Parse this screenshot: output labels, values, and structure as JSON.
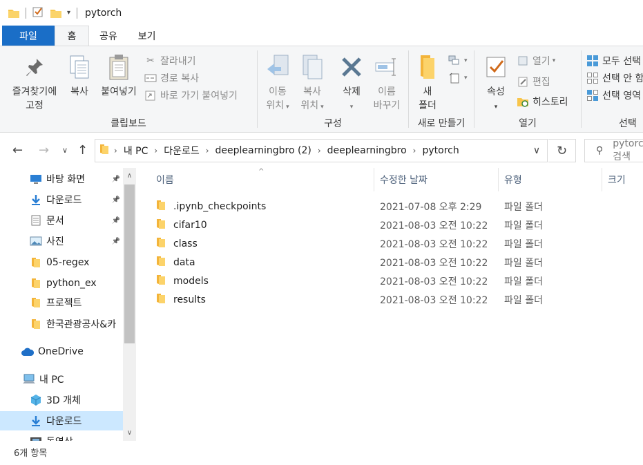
{
  "window": {
    "title": "pytorch"
  },
  "ribbon_tabs": [
    "파일",
    "홈",
    "공유",
    "보기"
  ],
  "ribbon": {
    "clipboard": {
      "label": "클립보드",
      "pin_line1": "즐겨찾기에",
      "pin_line2": "고정",
      "copy": "복사",
      "paste": "붙여넣기",
      "cut": "잘라내기",
      "copy_path": "경로 복사",
      "paste_shortcut": "바로 가기 붙여넣기"
    },
    "organize": {
      "label": "구성",
      "move_line1": "이동",
      "move_line2": "위치",
      "copyto_line1": "복사",
      "copyto_line2": "위치",
      "delete": "삭제",
      "rename_line1": "이름",
      "rename_line2": "바꾸기"
    },
    "new": {
      "label": "새로 만들기",
      "newfolder_line1": "새",
      "newfolder_line2": "폴더"
    },
    "open": {
      "label": "열기",
      "properties": "속성",
      "open": "열기",
      "edit": "편집",
      "history": "히스토리"
    },
    "select": {
      "label": "선택",
      "select_all": "모두 선택",
      "select_none": "선택 안 함",
      "invert": "선택 영역 반전"
    }
  },
  "address": {
    "crumbs": [
      "내 PC",
      "다운로드",
      "deeplearningbro (2)",
      "deeplearningbro",
      "pytorch"
    ],
    "search_placeholder": "pytorch 검색"
  },
  "nav_pane": {
    "items": [
      {
        "label": "바탕 화면",
        "icon": "desktop-icon",
        "pinned": true
      },
      {
        "label": "다운로드",
        "icon": "download-arrow-icon",
        "pinned": true
      },
      {
        "label": "문서",
        "icon": "document-icon",
        "pinned": true
      },
      {
        "label": "사진",
        "icon": "picture-icon",
        "pinned": true
      },
      {
        "label": "05-regex",
        "icon": "folder-icon",
        "pinned": false
      },
      {
        "label": "python_ex",
        "icon": "folder-icon",
        "pinned": false
      },
      {
        "label": "프로젝트",
        "icon": "folder-icon",
        "pinned": false
      },
      {
        "label": "한국관광공사&카",
        "icon": "folder-icon",
        "pinned": false
      },
      {
        "label": "OneDrive",
        "icon": "cloud-icon",
        "pinned": false
      },
      {
        "label": "내 PC",
        "icon": "computer-icon",
        "pinned": false
      },
      {
        "label": "3D 개체",
        "icon": "cube-icon",
        "pinned": false
      },
      {
        "label": "다운로드",
        "icon": "download-arrow-icon",
        "pinned": false,
        "selected": true
      },
      {
        "label": "동영상",
        "icon": "film-icon",
        "pinned": false
      }
    ]
  },
  "file_list": {
    "columns": [
      "이름",
      "수정한 날짜",
      "유형",
      "크기"
    ],
    "rows": [
      {
        "name": ".ipynb_checkpoints",
        "date": "2021-07-08 오후 2:29",
        "type": "파일 폴더"
      },
      {
        "name": "cifar10",
        "date": "2021-08-03 오전 10:22",
        "type": "파일 폴더"
      },
      {
        "name": "class",
        "date": "2021-08-03 오전 10:22",
        "type": "파일 폴더"
      },
      {
        "name": "data",
        "date": "2021-08-03 오전 10:22",
        "type": "파일 폴더"
      },
      {
        "name": "models",
        "date": "2021-08-03 오전 10:22",
        "type": "파일 폴더"
      },
      {
        "name": "results",
        "date": "2021-08-03 오전 10:22",
        "type": "파일 폴더"
      }
    ]
  },
  "status": {
    "item_count": "6개 항목"
  },
  "colors": {
    "file_tab": "#1a6ec7",
    "folder": "#f8c54b",
    "selected": "#cce8ff"
  }
}
